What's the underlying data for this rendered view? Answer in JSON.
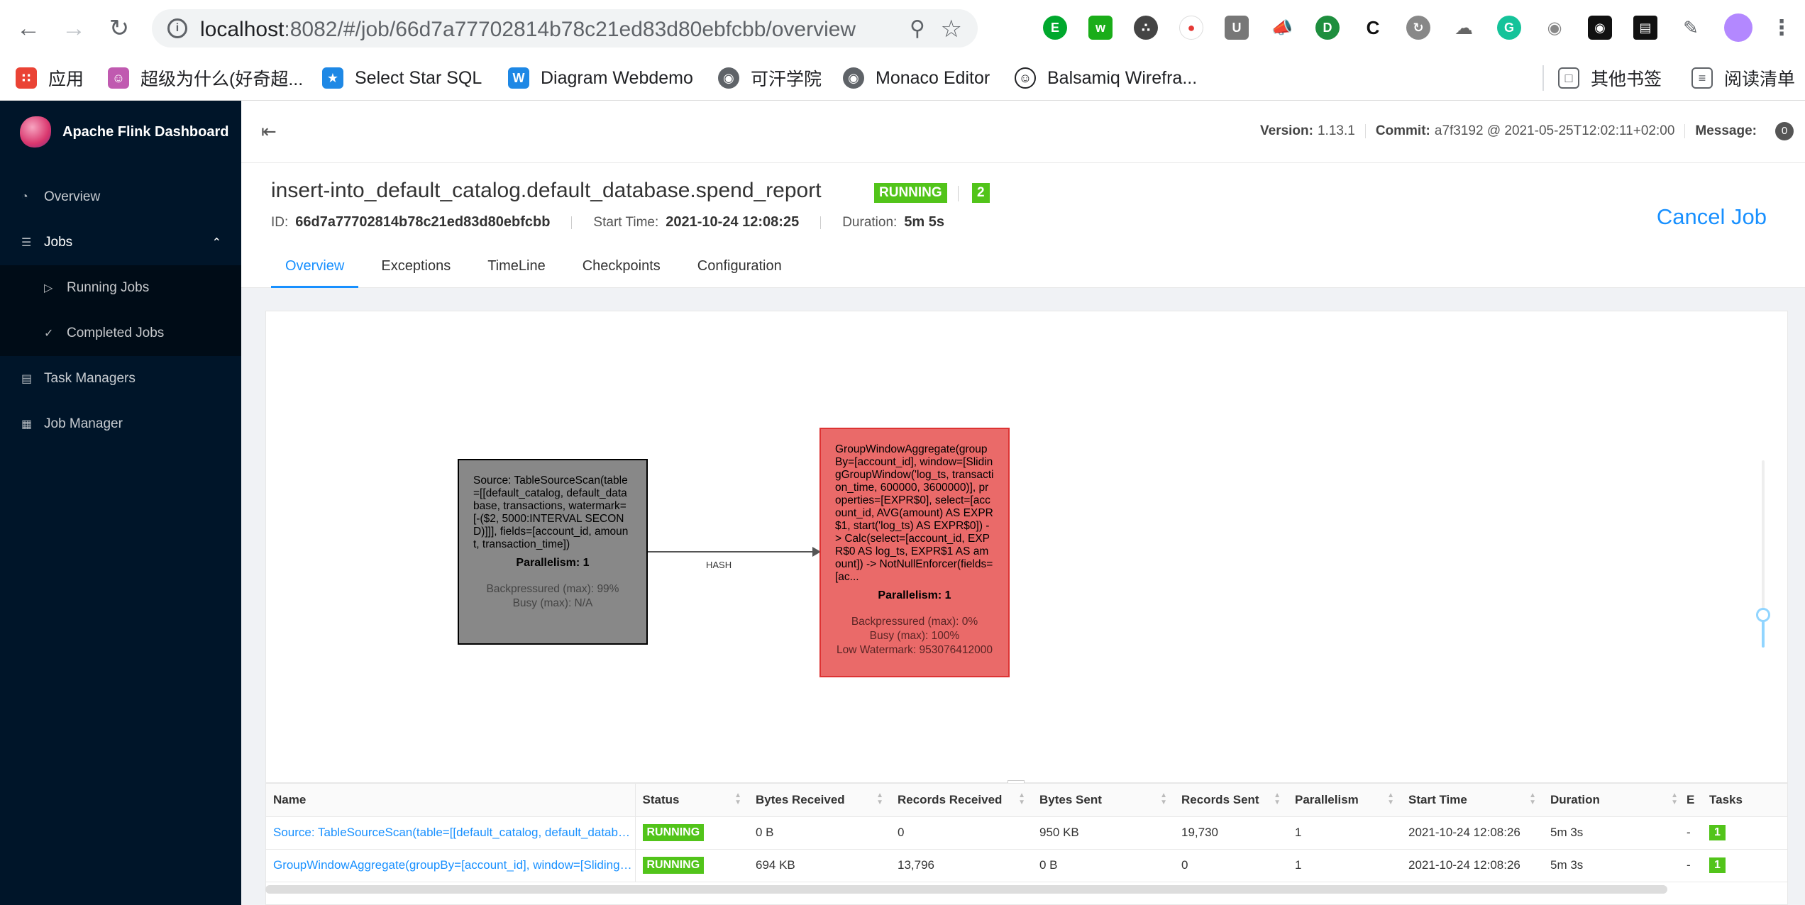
{
  "browser": {
    "url_host": "localhost",
    "url_rest": ":8082/#/job/66d7a77702814b78c21ed83d80ebfcbb/overview",
    "bookmarks": [
      {
        "label": "应用",
        "icon": "apps-grid-icon",
        "color": "#ea4335"
      },
      {
        "label": "超级为什么(好奇超...",
        "icon": "cartoon-face-icon",
        "color": "#c05ab0"
      },
      {
        "label": "Select Star SQL",
        "icon": "star-logo-icon",
        "color": "#1e88e5"
      },
      {
        "label": "Diagram Webdemo",
        "icon": "w-logo-icon",
        "color": "#1e88e5"
      },
      {
        "label": "可汗学院",
        "icon": "globe-icon",
        "color": "#5f6368"
      },
      {
        "label": "Monaco Editor",
        "icon": "globe-icon",
        "color": "#5f6368"
      },
      {
        "label": "Balsamiq Wirefra...",
        "icon": "smiley-icon",
        "color": "#202124"
      }
    ],
    "other_bookmarks": "其他书签",
    "reading_list": "阅读清单"
  },
  "sidebar": {
    "app_name": "Apache Flink Dashboard",
    "items": [
      {
        "label": "Overview",
        "icon": "dashboard-icon"
      },
      {
        "label": "Jobs",
        "icon": "list-icon"
      },
      {
        "label": "Running Jobs",
        "icon": "play-circle-icon"
      },
      {
        "label": "Completed Jobs",
        "icon": "check-circle-icon"
      },
      {
        "label": "Task Managers",
        "icon": "schedule-icon"
      },
      {
        "label": "Job Manager",
        "icon": "cluster-icon"
      }
    ]
  },
  "header": {
    "version_label": "Version:",
    "version": "1.13.1",
    "commit_label": "Commit:",
    "commit": "a7f3192 @ 2021-05-25T12:02:11+02:00",
    "message_label": "Message:",
    "message_count": "0"
  },
  "job": {
    "name": "insert-into_default_catalog.default_database.spend_report",
    "status": "RUNNING",
    "tasks": "2",
    "id_label": "ID:",
    "id": "66d7a77702814b78c21ed83d80ebfcbb",
    "start_label": "Start Time:",
    "start_time": "2021-10-24 12:08:25",
    "duration_label": "Duration:",
    "duration": "5m 5s",
    "cancel": "Cancel Job",
    "tabs": [
      "Overview",
      "Exceptions",
      "TimeLine",
      "Checkpoints",
      "Configuration"
    ]
  },
  "graph": {
    "nodes": [
      {
        "description": "Source: TableSourceScan(table=[[default_catalog, default_database, transactions, watermark=[-($2, 5000:INTERVAL SECOND)]]], fields=[account_id, amount, transaction_time])",
        "parallelism": "Parallelism: 1",
        "backpressured": "Backpressured (max): 99%",
        "busy": "Busy (max): N/A",
        "watermark": ""
      },
      {
        "description": "GroupWindowAggregate(groupBy=[account_id], window=[SlidingGroupWindow('log_ts, transaction_time, 600000, 3600000)], properties=[EXPR$0], select=[account_id, AVG(amount) AS EXPR$1, start('log_ts) AS EXPR$0]) -> Calc(select=[account_id, EXPR$0 AS log_ts, EXPR$1 AS amount]) -> NotNullEnforcer(fields=[ac...",
        "parallelism": "Parallelism: 1",
        "backpressured": "Backpressured (max): 0%",
        "busy": "Busy (max): 100%",
        "watermark": "Low Watermark: 953076412000"
      }
    ],
    "edge_label": "HASH",
    "resize_handle": "..."
  },
  "table": {
    "columns": [
      "Name",
      "Status",
      "Bytes Received",
      "Records Received",
      "Bytes Sent",
      "Records Sent",
      "Parallelism",
      "Start Time",
      "Duration",
      "E",
      "Tasks"
    ],
    "rows": [
      {
        "name": "Source: TableSourceScan(table=[[default_catalog, default_database, transactions, watermark=[-($2, 5000:INTERVAL SECOND)]]], fields=[account_id, amount, transaction_time])",
        "status": "RUNNING",
        "bytes_received": "0 B",
        "records_received": "0",
        "bytes_sent": "950 KB",
        "records_sent": "19,730",
        "parallelism": "1",
        "start_time": "2021-10-24 12:08:26",
        "duration": "5m 3s",
        "end": "-",
        "tasks": "1"
      },
      {
        "name": "GroupWindowAggregate(groupBy=[account_id], window=[SlidingGroupWindow('log_ts, transaction_time, 600000, 3600000)], properties=[EXPR$0], select=[account_id, AVG(amount) AS EXPR$1, start('log_ts) AS EXPR$0])",
        "status": "RUNNING",
        "bytes_received": "694 KB",
        "records_received": "13,796",
        "bytes_sent": "0 B",
        "records_sent": "0",
        "parallelism": "1",
        "start_time": "2021-10-24 12:08:26",
        "duration": "5m 3s",
        "end": "-",
        "tasks": "1"
      }
    ]
  },
  "colors": {
    "sidebar_bg": "#001529",
    "accent": "#1890ff",
    "running": "#52c41a",
    "node_source": "#888888",
    "node_busy": "#ea6a69"
  }
}
